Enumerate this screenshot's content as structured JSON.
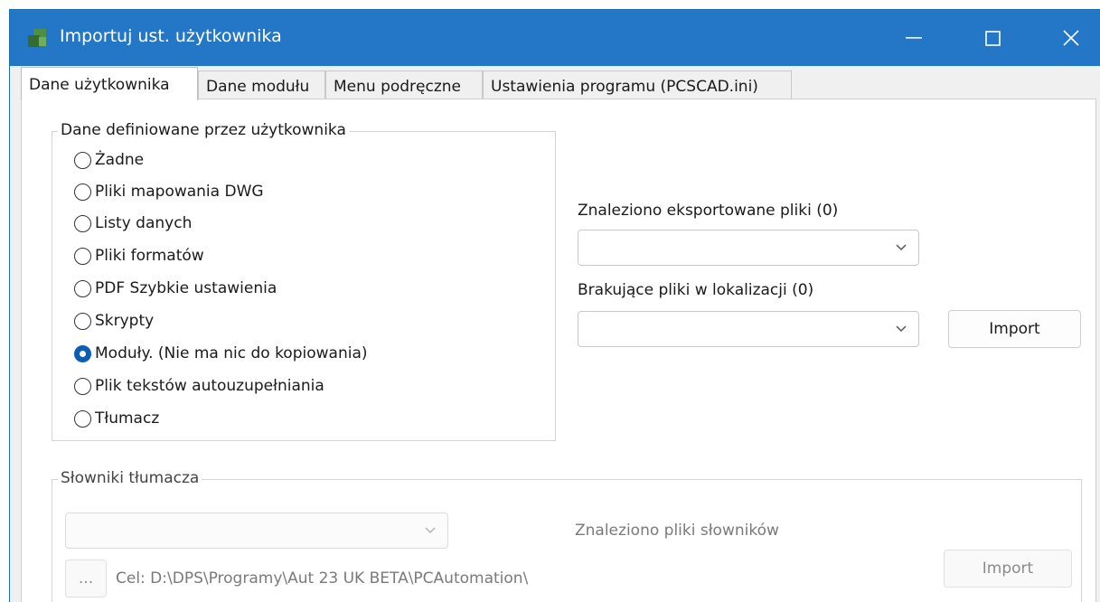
{
  "window": {
    "title": "Importuj ust. użytkownika",
    "accent": "#2377c6"
  },
  "tabs": [
    {
      "label": "Dane użytkownika",
      "active": true
    },
    {
      "label": "Dane modułu",
      "active": false
    },
    {
      "label": "Menu podręczne",
      "active": false
    },
    {
      "label": "Ustawienia programu (PCSCAD.ini)",
      "active": false
    }
  ],
  "user_data_group": {
    "label": "Dane definiowane przez użytkownika",
    "options": [
      {
        "label": "Żadne",
        "checked": false
      },
      {
        "label": "Pliki mapowania DWG",
        "checked": false
      },
      {
        "label": "Listy danych",
        "checked": false
      },
      {
        "label": "Pliki formatów",
        "checked": false
      },
      {
        "label": "PDF Szybkie ustawienia",
        "checked": false
      },
      {
        "label": "Skrypty",
        "checked": false
      },
      {
        "label": "Moduły. (Nie ma nic do kopiowania)",
        "checked": true
      },
      {
        "label": "Plik tekstów autouzupełniania",
        "checked": false
      },
      {
        "label": "Tłumacz",
        "checked": false
      }
    ]
  },
  "found_exported": {
    "label": "Znaleziono eksportowane pliki (0)",
    "value": ""
  },
  "missing_files": {
    "label": "Brakujące pliki w lokalizacji (0)",
    "value": ""
  },
  "import_button": {
    "label": "Import"
  },
  "translator_group": {
    "label": "Słowniki tłumacza",
    "dictionary_value": "",
    "found_label": "Znaleziono pliki słowników",
    "browse_label": "...",
    "target_path": "Cel: D:\\DPS\\Programy\\Aut 23 UK BETA\\PCAutomation\\",
    "import_label": "Import"
  }
}
